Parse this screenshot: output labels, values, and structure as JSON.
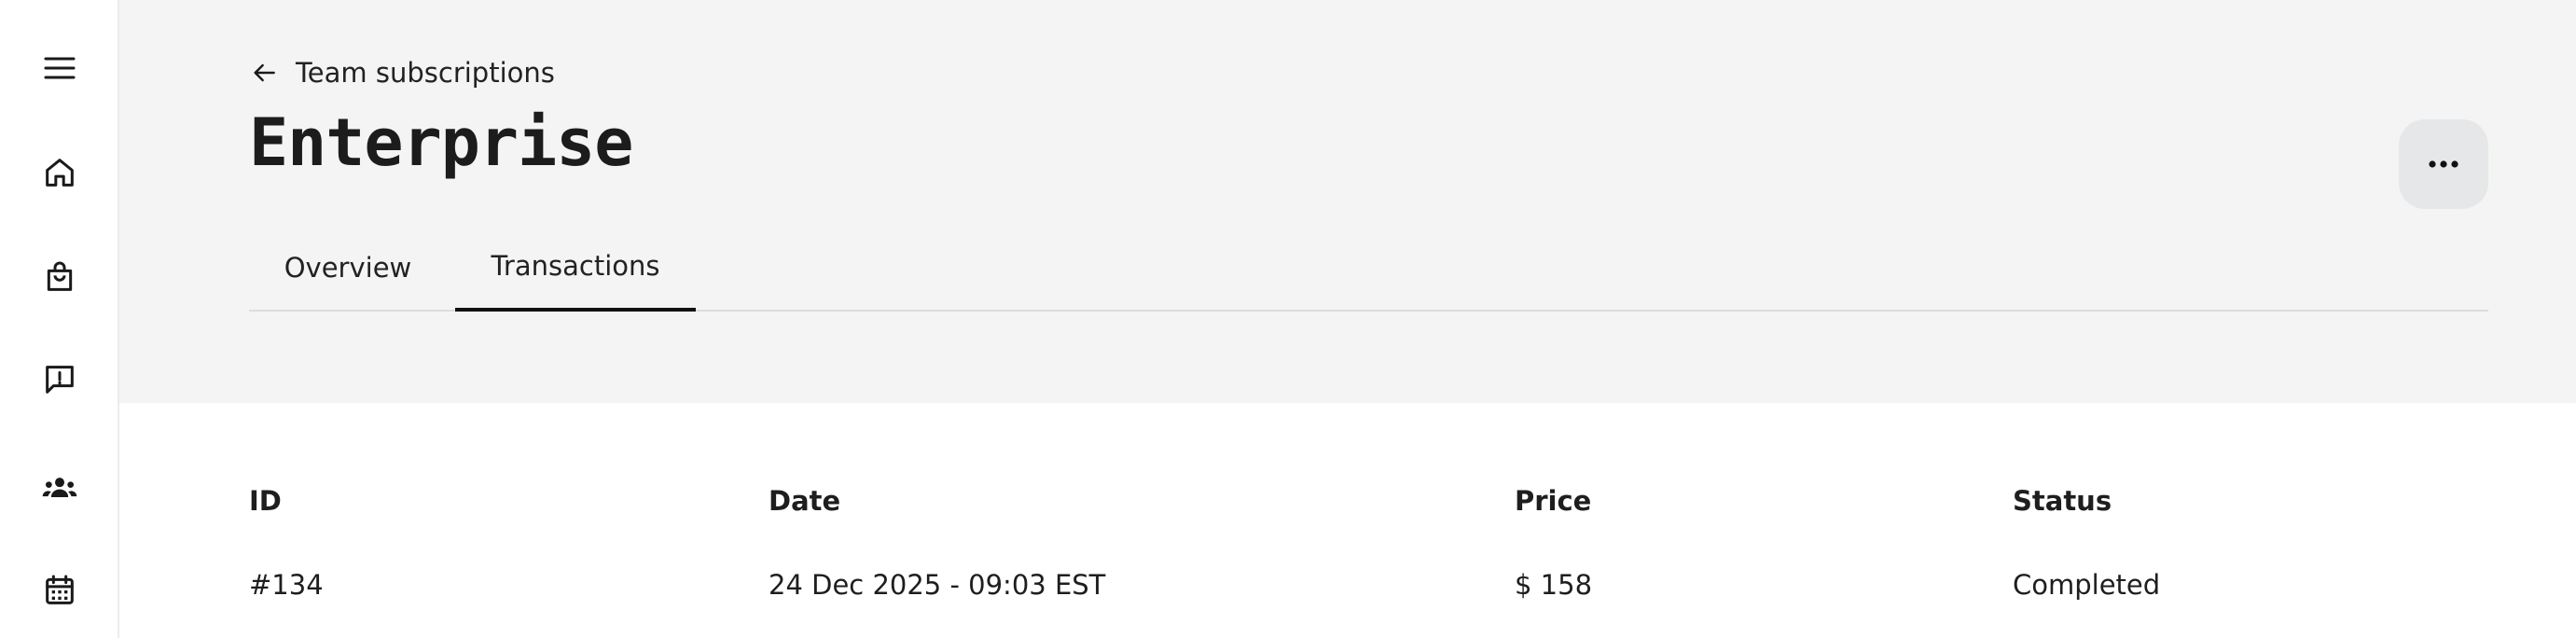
{
  "sidebar": {
    "items": [
      {
        "icon": "menu-icon"
      },
      {
        "icon": "home-icon"
      },
      {
        "icon": "shopping-bag-icon"
      },
      {
        "icon": "feedback-icon"
      },
      {
        "icon": "team-icon"
      },
      {
        "icon": "calendar-icon"
      }
    ]
  },
  "header": {
    "back_label": "Team subscriptions",
    "title": "Enterprise",
    "more_icon": "more-horizontal-icon"
  },
  "tabs": [
    {
      "label": "Overview",
      "active": false
    },
    {
      "label": "Transactions",
      "active": true
    }
  ],
  "table": {
    "columns": [
      "ID",
      "Date",
      "Price",
      "Status"
    ],
    "rows": [
      [
        "#134",
        "24 Dec 2025 - 09:03 EST",
        "$ 158",
        "Completed"
      ]
    ]
  }
}
